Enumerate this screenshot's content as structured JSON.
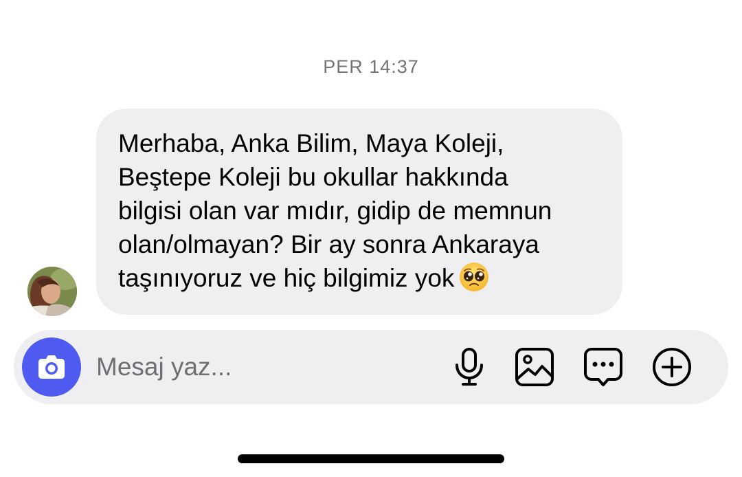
{
  "thread": {
    "timestamp": "PER 14:37"
  },
  "message": {
    "lines": [
      "Merhaba, Anka Bilim, Maya Koleji,",
      "Beştepe Koleji bu okullar hakkında",
      "bilgisi olan var mıdır, gidip de memnun",
      "olan/olmayan? Bir ay sonra Ankaraya",
      "taşınıyoruz ve hiç bilgimiz yok"
    ],
    "emoji": "pleading-face"
  },
  "composer": {
    "placeholder": "Mesaj yaz...",
    "value": "",
    "icons": {
      "camera": "camera-icon",
      "microphone": "microphone-icon",
      "gallery": "gallery-icon",
      "sticker": "chat-bubble-icon",
      "plus": "plus-circle-icon"
    }
  },
  "colors": {
    "bubble": "#efeff1",
    "accent": "#4f5bf0",
    "timestamp": "#737373"
  }
}
